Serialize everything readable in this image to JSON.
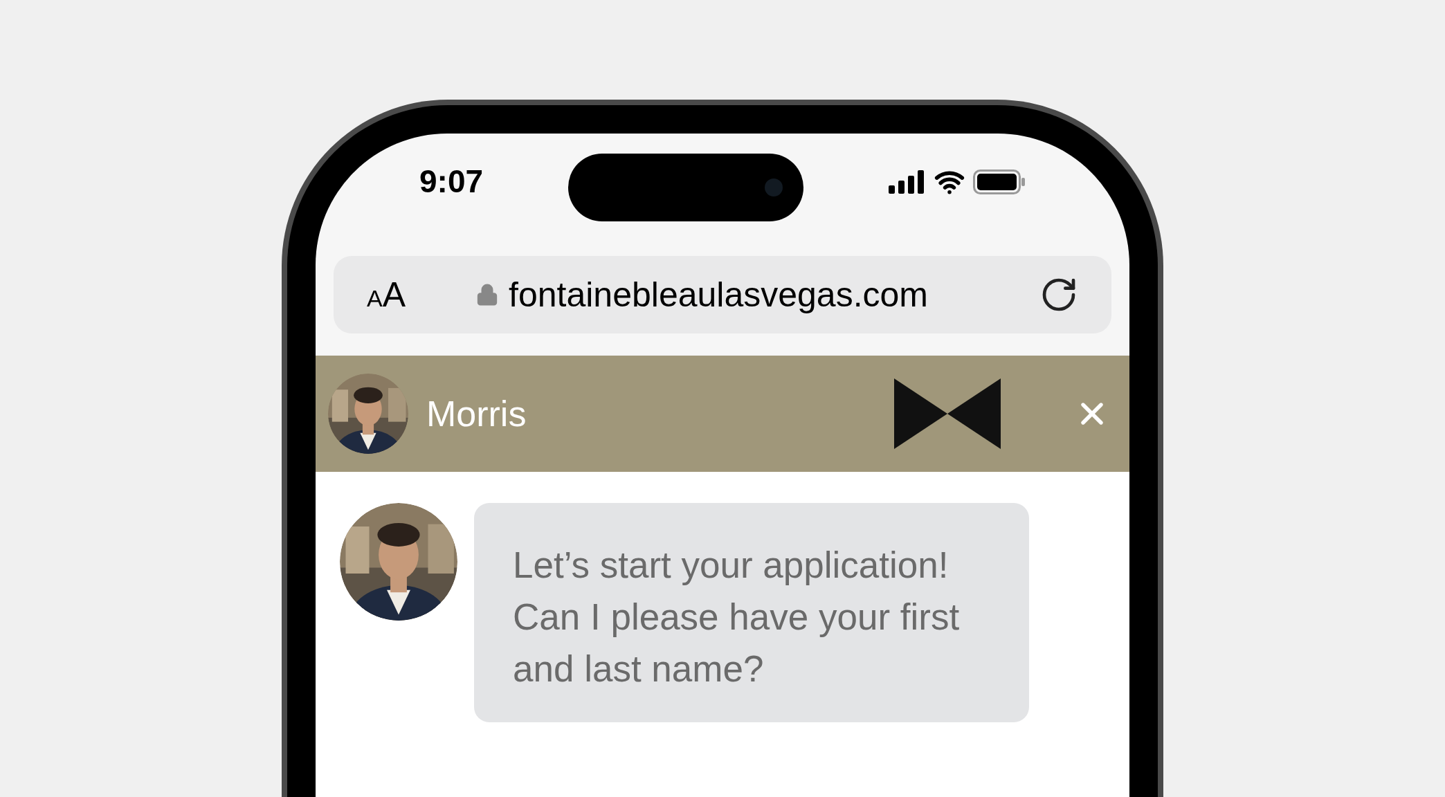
{
  "status_bar": {
    "time": "9:07"
  },
  "address_bar": {
    "text_size": {
      "small": "A",
      "large": "A"
    },
    "url": "fontainebleaulasvegas.com"
  },
  "chat_header": {
    "name": "Morris"
  },
  "messages": [
    {
      "kind": "incoming",
      "text": "Let’s start your application! Can I please have your first and last name?"
    }
  ]
}
